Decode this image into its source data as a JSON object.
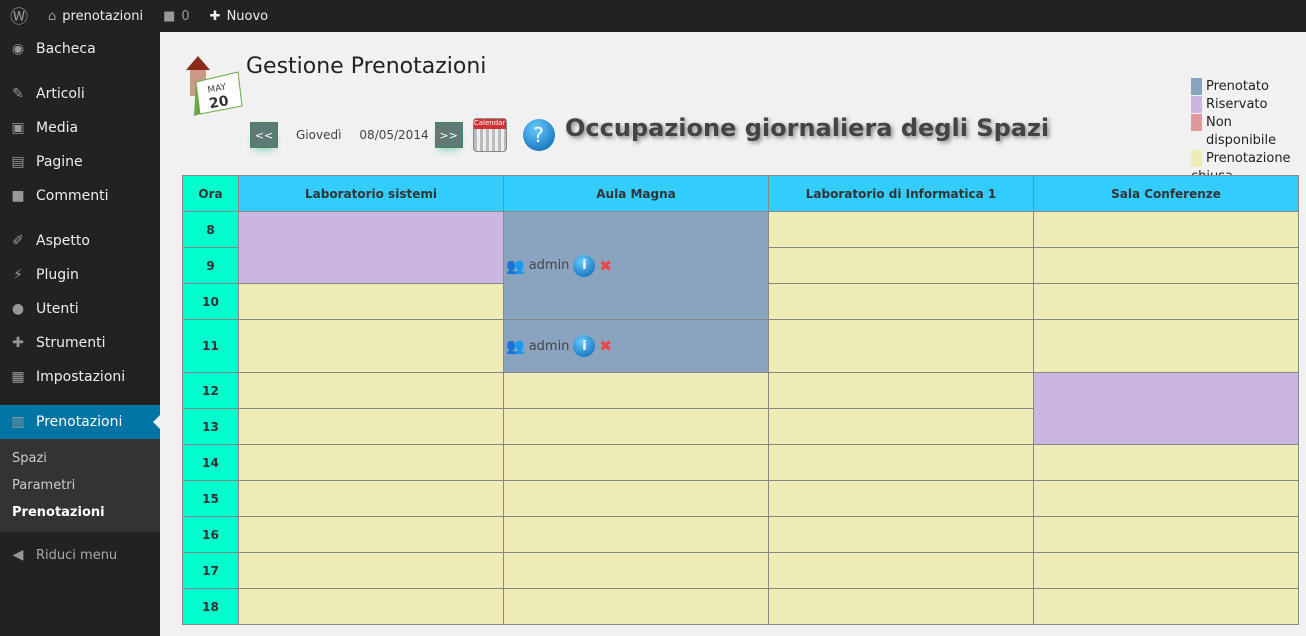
{
  "adminbar": {
    "site": "prenotazioni",
    "comments": "0",
    "new": "Nuovo"
  },
  "sidebar": {
    "items": [
      {
        "label": "Bacheca",
        "icon": "dashboard-icon",
        "glyph": "◉"
      },
      {
        "label": "Articoli",
        "icon": "pin-icon",
        "glyph": "✎"
      },
      {
        "label": "Media",
        "icon": "media-icon",
        "glyph": "▣"
      },
      {
        "label": "Pagine",
        "icon": "pages-icon",
        "glyph": "▤"
      },
      {
        "label": "Commenti",
        "icon": "comment-icon",
        "glyph": "■"
      },
      {
        "label": "Aspetto",
        "icon": "brush-icon",
        "glyph": "✐"
      },
      {
        "label": "Plugin",
        "icon": "plugin-icon",
        "glyph": "⚡"
      },
      {
        "label": "Utenti",
        "icon": "user-icon",
        "glyph": "●"
      },
      {
        "label": "Strumenti",
        "icon": "wrench-icon",
        "glyph": "✚"
      },
      {
        "label": "Impostazioni",
        "icon": "settings-icon",
        "glyph": "▦"
      },
      {
        "label": "Prenotazioni",
        "icon": "booking-icon",
        "glyph": "▥"
      }
    ],
    "submenu": [
      "Spazi",
      "Parametri",
      "Prenotazioni"
    ],
    "collapse": "Riduci menu"
  },
  "page": {
    "title": "Gestione Prenotazioni",
    "logo_text": "MAY 20",
    "prev": "<<",
    "next": ">>",
    "day": "Giovedì",
    "date": "08/05/2014",
    "calendar_label": "Calendar",
    "heading": "Occupazione giornaliera degli Spazi"
  },
  "legend": [
    {
      "label": "Prenotato",
      "color": "#8aa4bf"
    },
    {
      "label": "Riservato",
      "color": "#cbb5e1"
    },
    {
      "label": "Non disponibile",
      "color": "#e0989a"
    },
    {
      "label": "Prenotazione chiusa",
      "color": "#f0ecb8"
    }
  ],
  "table": {
    "ora_label": "Ora",
    "hours": [
      "8",
      "9",
      "10",
      "11",
      "12",
      "13",
      "14",
      "15",
      "16",
      "17",
      "18"
    ],
    "spaces": [
      "Laboratorio sistemi",
      "Aula Magna",
      "Laboratorio di Informatica 1",
      "Sala Conferenze"
    ],
    "blocks": [
      {
        "space": 0,
        "start": 0,
        "span": 2,
        "status": "Riservato"
      },
      {
        "space": 1,
        "start": 0,
        "span": 3,
        "status": "Prenotato",
        "user": "admin"
      },
      {
        "space": 1,
        "start": 3,
        "span": 1,
        "status": "Prenotato",
        "user": "admin"
      },
      {
        "space": 3,
        "start": 4,
        "span": 2,
        "status": "Riservato"
      }
    ]
  }
}
